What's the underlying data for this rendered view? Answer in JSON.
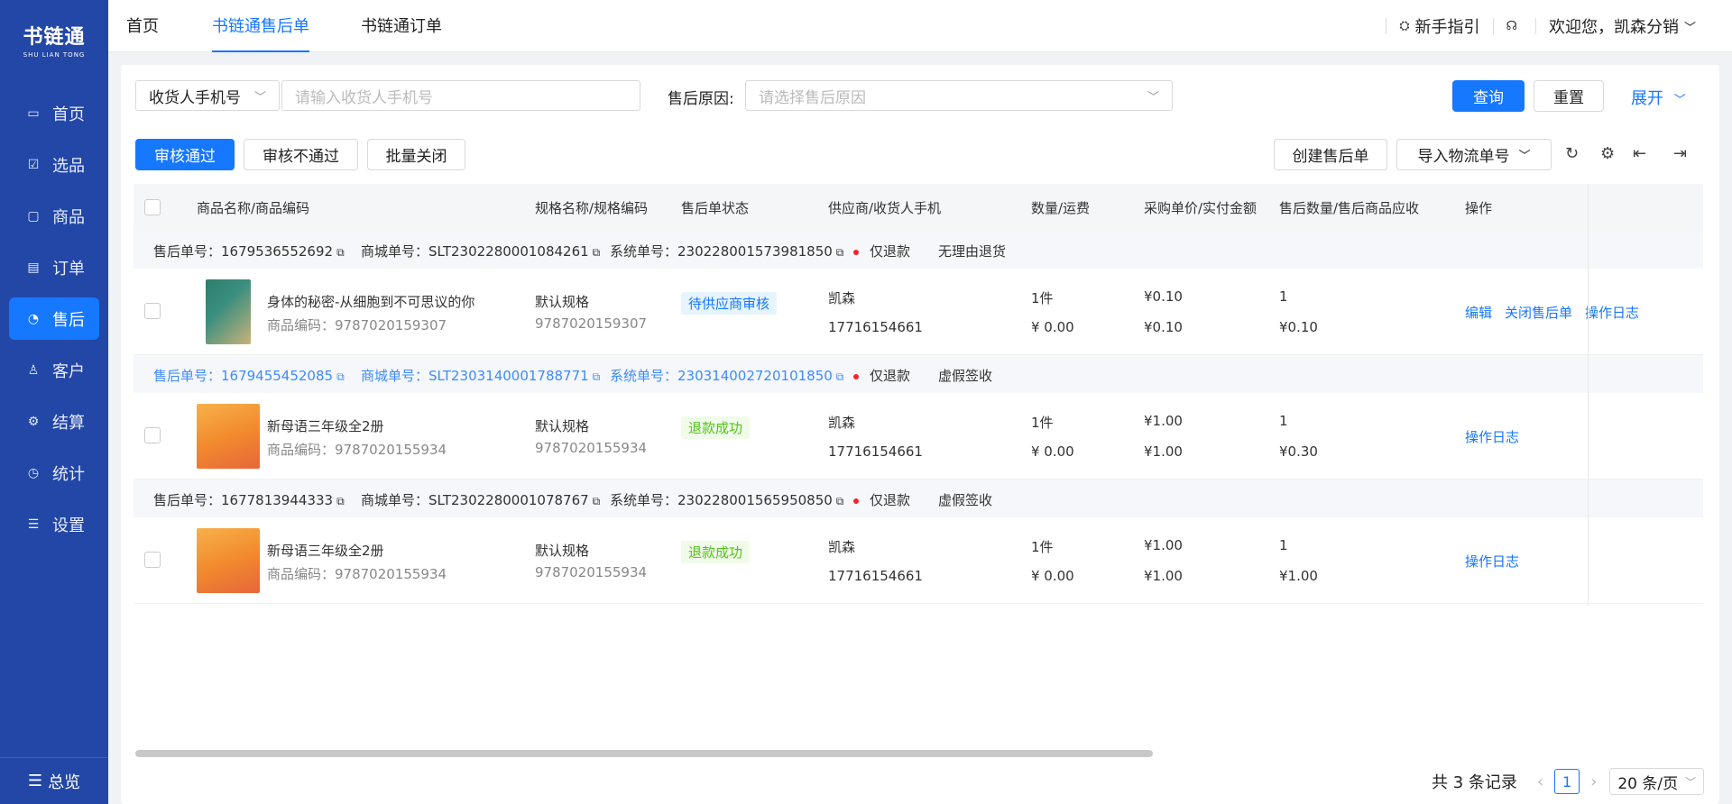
{
  "sidebar": {
    "logo_cn": "书链通",
    "logo_en": "SHU LIAN TONG",
    "items": [
      {
        "label": "首页",
        "icon": "monitor-icon",
        "glyph": "▭"
      },
      {
        "label": "选品",
        "icon": "select-icon",
        "glyph": "☑"
      },
      {
        "label": "商品",
        "icon": "box-icon",
        "glyph": "▢"
      },
      {
        "label": "订单",
        "icon": "order-icon",
        "glyph": "▤"
      },
      {
        "label": "售后",
        "icon": "headset-icon",
        "glyph": "◔"
      },
      {
        "label": "客户",
        "icon": "customer-icon",
        "glyph": "♙"
      },
      {
        "label": "结算",
        "icon": "settle-icon",
        "glyph": "⚙"
      },
      {
        "label": "统计",
        "icon": "chart-icon",
        "glyph": "◷"
      },
      {
        "label": "设置",
        "icon": "settings-icon",
        "glyph": "☰"
      }
    ],
    "active": "售后",
    "bottom_label": "总览",
    "bottom_glyph": "☰"
  },
  "topbar": {
    "tabs": [
      "首页",
      "书链通售后单",
      "书链通订单"
    ],
    "active_tab": "书链通售后单",
    "guide": "新手指引",
    "welcome": "欢迎您，凯森分销",
    "user_chevron": "﹀"
  },
  "filters": {
    "phone_type": "收货人手机号",
    "phone_placeholder": "请输入收货人手机号",
    "reason_label": "售后原因:",
    "reason_placeholder": "请选择售后原因",
    "query": "查询",
    "reset": "重置",
    "expand": "展开"
  },
  "actions": {
    "approve": "审核通过",
    "reject": "审核不通过",
    "batch_close": "批量关闭",
    "create": "创建售后单",
    "import": "导入物流单号"
  },
  "columns": [
    "商品名称/商品编码",
    "规格名称/规格编码",
    "售后单状态",
    "供应商/收货人手机",
    "数量/运费",
    "采购单价/实付金额",
    "售后数量/售后商品应收",
    "操作"
  ],
  "orders": [
    {
      "after_no": "售后单号：1679536552692",
      "mall_no": "商城单号：SLT2302280001084261",
      "sys_no": "系统单号：230228001573981850",
      "refund": "仅退款",
      "reason": "无理由退货",
      "product": "身体的秘密-从细胞到不可思议的你",
      "code": "商品编码：9787020159307",
      "spec": "默认规格",
      "spec_code": "9787020159307",
      "status": "待供应商审核",
      "status_kind": "blue",
      "supplier": "凯森",
      "phone": "17716154661",
      "qty": "1件",
      "freight": "¥ 0.00",
      "price": "¥0.10",
      "paid": "¥0.10",
      "after_qty": "1",
      "receivable": "¥0.10",
      "ops": [
        "编辑",
        "关闭售后单",
        "操作日志"
      ],
      "highlight": false
    },
    {
      "after_no": "售后单号：1679455452085",
      "mall_no": "商城单号：SLT2303140001788771",
      "sys_no": "系统单号：230314002720101850",
      "refund": "仅退款",
      "reason": "虚假签收",
      "product": "新母语三年级全2册",
      "code": "商品编码：9787020155934",
      "spec": "默认规格",
      "spec_code": "9787020155934",
      "status": "退款成功",
      "status_kind": "green",
      "supplier": "凯森",
      "phone": "17716154661",
      "qty": "1件",
      "freight": "¥ 0.00",
      "price": "¥1.00",
      "paid": "¥1.00",
      "after_qty": "1",
      "receivable": "¥0.30",
      "ops": [
        "操作日志"
      ],
      "highlight": true
    },
    {
      "after_no": "售后单号：1677813944333",
      "mall_no": "商城单号：SLT2302280001078767",
      "sys_no": "系统单号：230228001565950850",
      "refund": "仅退款",
      "reason": "虚假签收",
      "product": "新母语三年级全2册",
      "code": "商品编码：9787020155934",
      "spec": "默认规格",
      "spec_code": "9787020155934",
      "status": "退款成功",
      "status_kind": "green",
      "supplier": "凯森",
      "phone": "17716154661",
      "qty": "1件",
      "freight": "¥ 0.00",
      "price": "¥1.00",
      "paid": "¥1.00",
      "after_qty": "1",
      "receivable": "¥1.00",
      "ops": [
        "操作日志"
      ],
      "highlight": false
    }
  ],
  "pagination": {
    "total": "共 3 条记录",
    "page": "1",
    "page_size": "20 条/页",
    "prev": "‹",
    "next": "›"
  },
  "colors": {
    "sidebar": "#2347a6",
    "primary": "#1677ff"
  }
}
